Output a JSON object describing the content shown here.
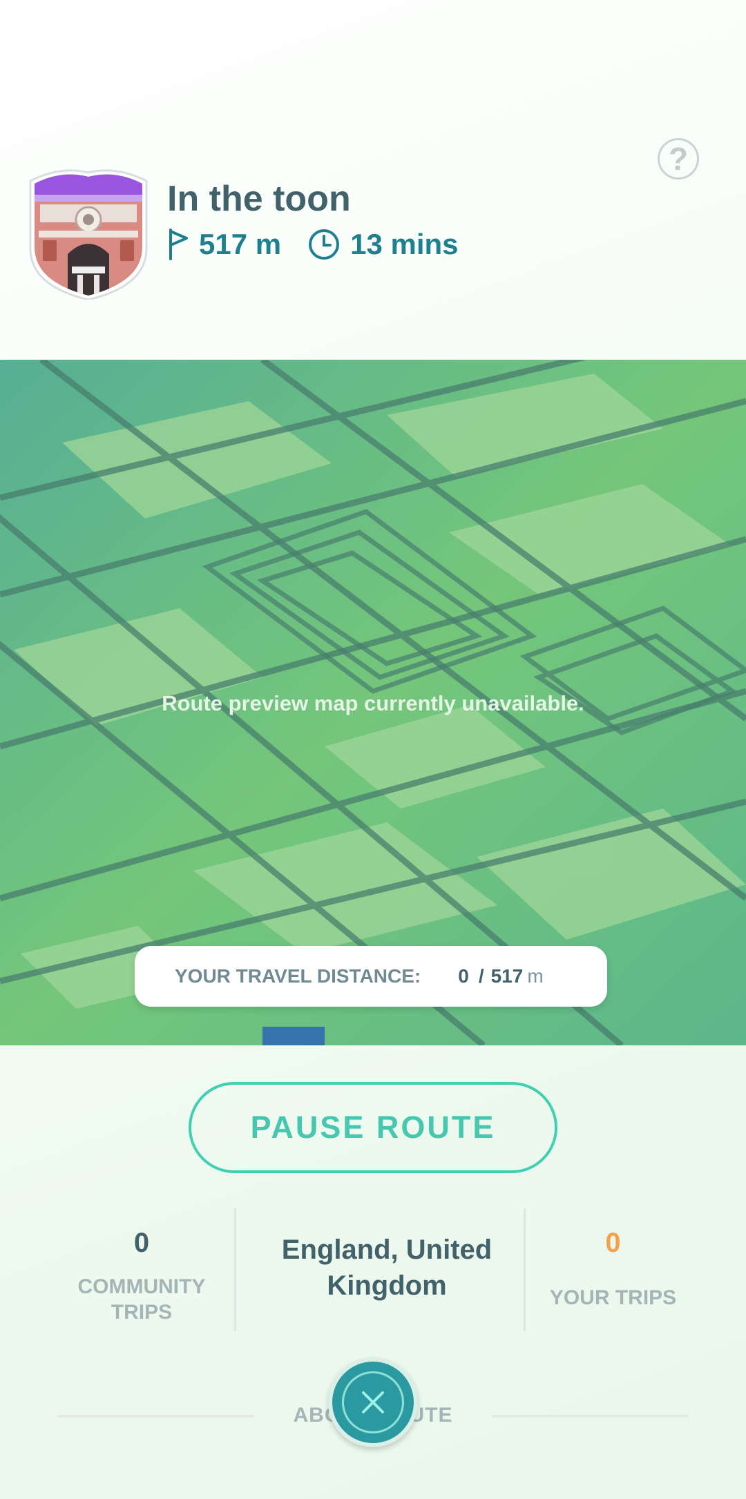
{
  "route": {
    "title": "In the toon",
    "distance": "517 m",
    "duration": "13 mins"
  },
  "help": {
    "label": "?"
  },
  "map": {
    "message": "Route preview map currently unavailable."
  },
  "travel": {
    "label": "YOUR TRAVEL DISTANCE:",
    "current": "0",
    "separator": "/",
    "total": "517",
    "unit": "m"
  },
  "actions": {
    "pause_label": "PAUSE ROUTE"
  },
  "stats": {
    "community_trips_value": "0",
    "community_trips_label_1": "COMMUNITY",
    "community_trips_label_2": "TRIPS",
    "location_line_1": "England, United",
    "location_line_2": "Kingdom",
    "your_trips_value": "0",
    "your_trips_label": "YOUR TRIPS"
  },
  "about": {
    "label": "ABOUT ROUTE"
  },
  "colors": {
    "accent": "#45c7b0",
    "title": "#41626a",
    "stat_blue": "#1e7f8e",
    "your_trips_orange": "#f5a04a",
    "close_button": "#2a9aa0"
  },
  "icons": {
    "help": "question-mark-icon",
    "distance": "flag-icon",
    "duration": "clock-icon",
    "close": "close-icon"
  }
}
